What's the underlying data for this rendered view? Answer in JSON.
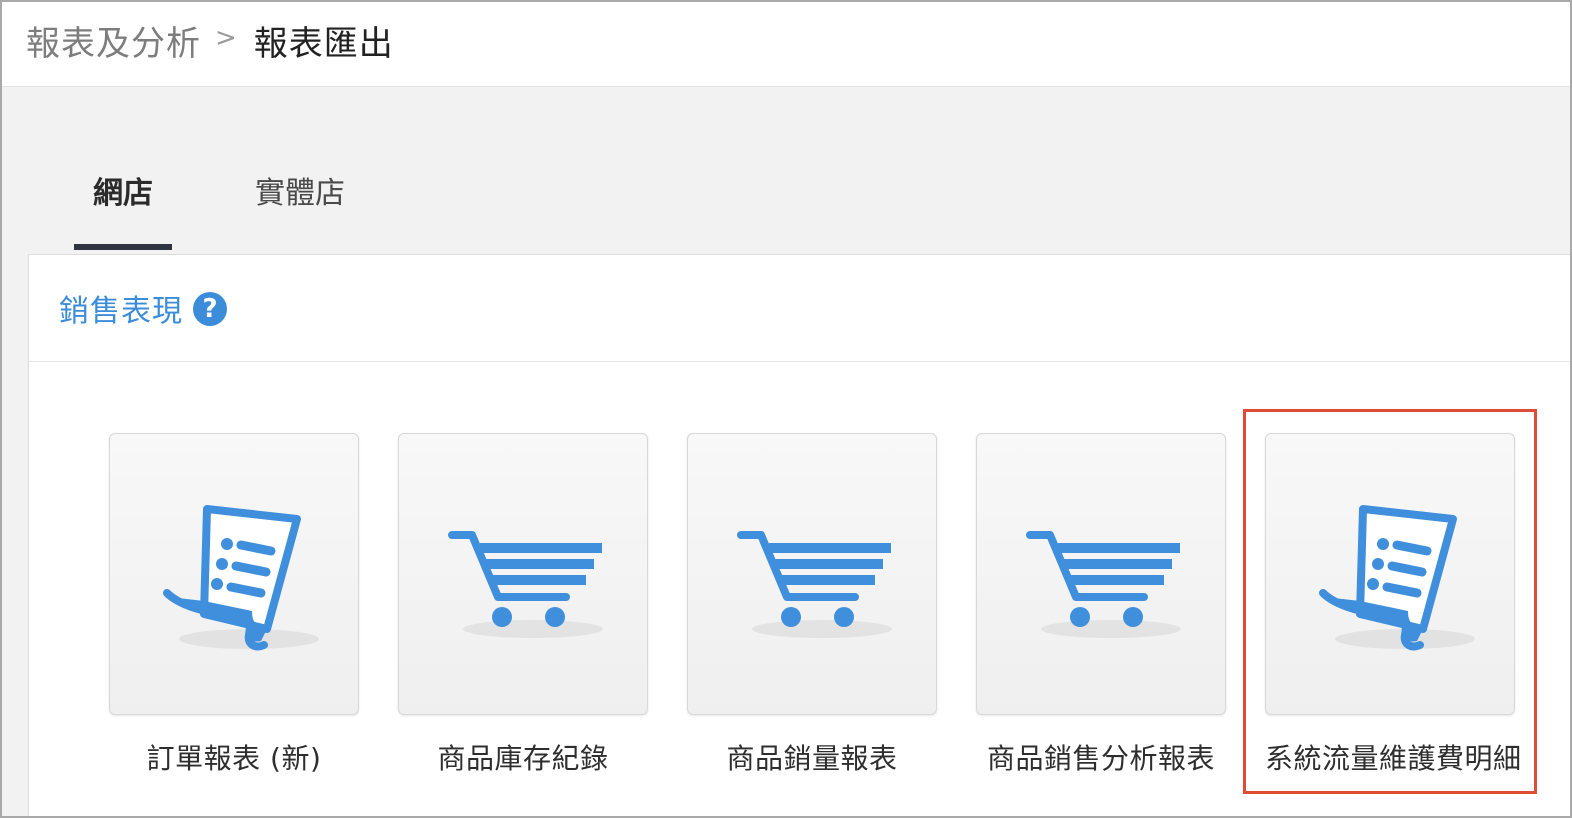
{
  "breadcrumb": {
    "parent": "報表及分析",
    "separator": ">",
    "current": "報表匯出"
  },
  "tabs": [
    {
      "label": "網店",
      "active": true
    },
    {
      "label": "實體店",
      "active": false
    }
  ],
  "section": {
    "title": "銷售表現",
    "help_icon": "question-circle-icon"
  },
  "reports": [
    {
      "label": "訂單報表 (新)",
      "icon": "document-icon"
    },
    {
      "label": "商品庫存紀錄",
      "icon": "cart-icon"
    },
    {
      "label": "商品銷量報表",
      "icon": "cart-icon"
    },
    {
      "label": "商品銷售分析報表",
      "icon": "cart-icon"
    },
    {
      "label": "系統流量維護費明細",
      "icon": "document-icon",
      "highlighted": true
    }
  ],
  "colors": {
    "accent": "#3c8dd9",
    "icon": "#3f8fdc",
    "highlight": "#e04a39",
    "tab_underline": "#2e3541"
  }
}
